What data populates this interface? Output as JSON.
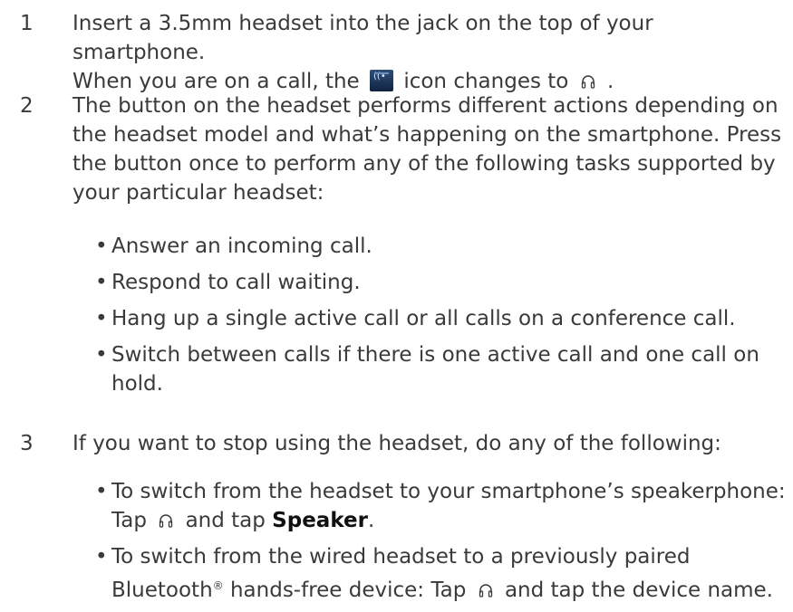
{
  "steps": [
    {
      "number": "1",
      "line1": "Insert a 3.5mm headset into the jack on the top of your smartphone.",
      "line2_before": "When you are on a call, the",
      "line2_middle": "icon changes to",
      "line2_after": "."
    },
    {
      "number": "2",
      "text": "The button on the headset performs different actions depending on the headset model and what’s happening on the smartphone. Press the button once to perform any of the following tasks supported by your particular headset:",
      "bullets": [
        "Answer an incoming call.",
        "Respond to call waiting.",
        "Hang up a single active call or all calls on a conference call.",
        "Switch between calls if there is one active call and one call on hold."
      ]
    },
    {
      "number": "3",
      "text": "If you want to stop using the headset, do any of the following:",
      "bullets": [
        {
          "text1": "To switch from the headset to your smartphone’s speakerphone: Tap",
          "text2": "and tap",
          "bold": "Speaker",
          "end": "."
        },
        {
          "text1": "To switch from the wired headset to a previously paired Bluetooth",
          "superscript": "®",
          "text2": "hands-free device: Tap",
          "text3": "and tap the device name."
        }
      ]
    }
  ],
  "icons": {
    "speaker": "speaker-icon",
    "speaker_label": "Speaker",
    "headset": "headset-icon"
  }
}
